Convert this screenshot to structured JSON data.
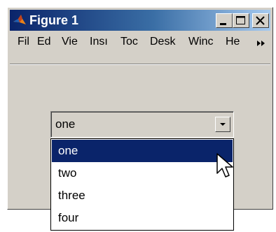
{
  "window": {
    "title": "Figure 1"
  },
  "icons": {
    "app": "matlab-logo-icon",
    "minimize": "minimize-icon",
    "maximize": "maximize-icon",
    "close": "close-icon",
    "menu_overflow": "chevron-double-right-icon",
    "dropdown_arrow": "chevron-down-icon",
    "cursor": "mouse-pointer-icon"
  },
  "menubar": {
    "file": "Fil",
    "edit": "Ed",
    "view": "Vie",
    "insert": "Insı",
    "tools": "Toc",
    "desktop": "Desk",
    "window": "Winc",
    "help": "He"
  },
  "popup": {
    "selected_value": "one",
    "options": [
      "one",
      "two",
      "three",
      "four"
    ],
    "highlighted_index": 0
  },
  "colors": {
    "titlebar_start": "#0a246a",
    "titlebar_end": "#a6caf0",
    "window_face": "#d4d0c8",
    "selection": "#0a246a"
  }
}
